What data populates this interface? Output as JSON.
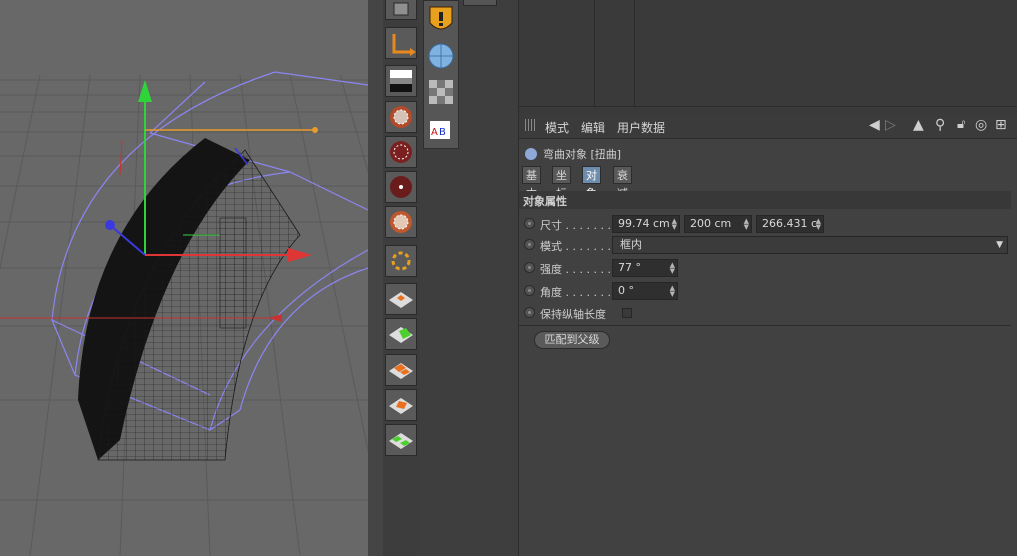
{
  "attributes": {
    "menu": [
      "模式",
      "编辑",
      "用户数据"
    ],
    "object_title": "弯曲对象 [扭曲]",
    "tabs": [
      {
        "label": "基本",
        "active": false
      },
      {
        "label": "坐标",
        "active": false
      },
      {
        "label": "对象",
        "active": true
      },
      {
        "label": "衰减",
        "active": false
      }
    ],
    "section_title": "对象属性",
    "fields": {
      "size": {
        "label": "尺寸 . . . . . . .",
        "x": "99.74 cm",
        "y": "200 cm",
        "z": "266.431 c"
      },
      "mode": {
        "label": "模式 . . . . . . .",
        "value": "框内"
      },
      "strength": {
        "label": "强度 . . . . . . .",
        "value": "77 °"
      },
      "angle": {
        "label": "角度 . . . . . . .",
        "value": "0 °"
      },
      "keep_length": {
        "label": "保持纵轴长度",
        "checked": false
      }
    },
    "match_parent_button": "匹配到父级"
  },
  "colors": {
    "viewport_bg": "#686868",
    "panel_bg": "#414141",
    "active_tab": "#6e8cad",
    "axis_y": "#2fd43a",
    "axis_x": "#e03535",
    "cage": "#8b86f0"
  },
  "icons": {
    "toolstrip": [
      "bone-icon",
      "gradient-icon",
      "bulge-icon",
      "twist-icon",
      "shear-icon",
      "bend-sphere-icon",
      "spline-deformer-icon",
      "plane-deformer-icon",
      "green-plane-icon",
      "orange-plane-icon",
      "orange-wrap-icon",
      "green-ffd-icon"
    ],
    "object_panel": [
      "warning-icon",
      "sphere-icon",
      "checker-icon",
      "text-icon"
    ]
  }
}
